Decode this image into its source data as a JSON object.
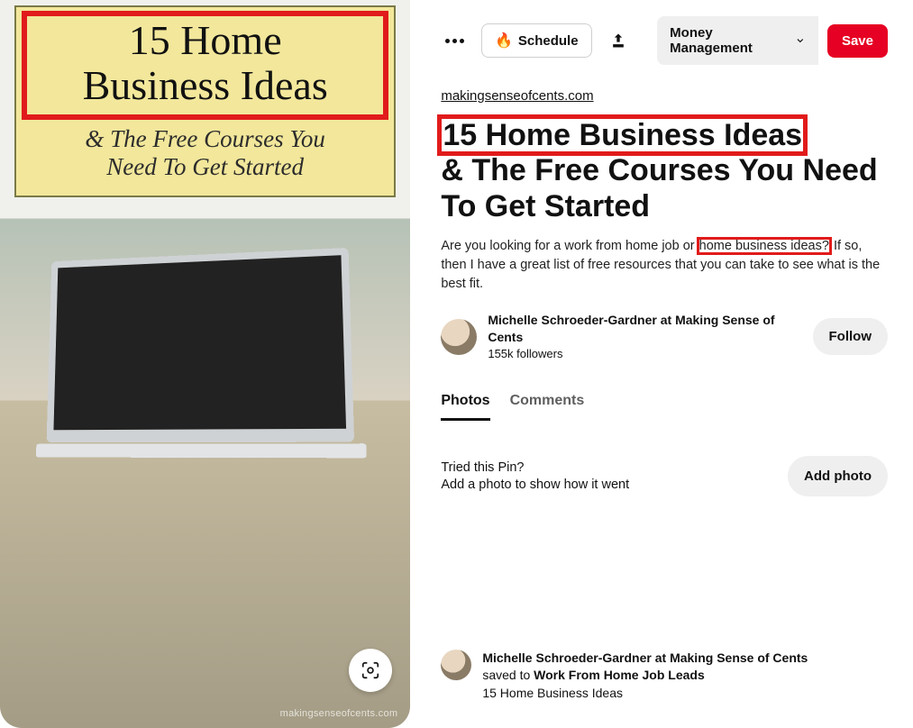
{
  "pin_card": {
    "headline": "15 Home\nBusiness Ideas",
    "subline": "& The Free Courses You\nNeed To Get Started",
    "watermark": "makingsenseofcents.com"
  },
  "toolbar": {
    "schedule_label": "Schedule",
    "board_name": "Money Management",
    "save_label": "Save"
  },
  "source_link": "makingsenseofcents.com",
  "title_line1": "15 Home Business Ideas",
  "title_rest": "& The Free Courses You Need To Get Started",
  "description_pre": "Are you looking for a work from home job or ",
  "description_highlight": "home business ideas?",
  "description_post": " If so, then I have a great list of free resources that you can take to see what is the best fit.",
  "author": {
    "name": "Michelle Schroeder-Gardner at Making Sense of Cents",
    "followers": "155k followers",
    "follow_label": "Follow"
  },
  "tabs": {
    "photos": "Photos",
    "comments": "Comments"
  },
  "tried": {
    "question": "Tried this Pin?",
    "hint": "Add a photo to show how it went",
    "button": "Add photo"
  },
  "saved": {
    "user": "Michelle Schroeder-Gardner at Making Sense of Cents",
    "prefix": "saved to ",
    "board": "Work From Home Job Leads",
    "subtitle": "15 Home Business Ideas"
  }
}
